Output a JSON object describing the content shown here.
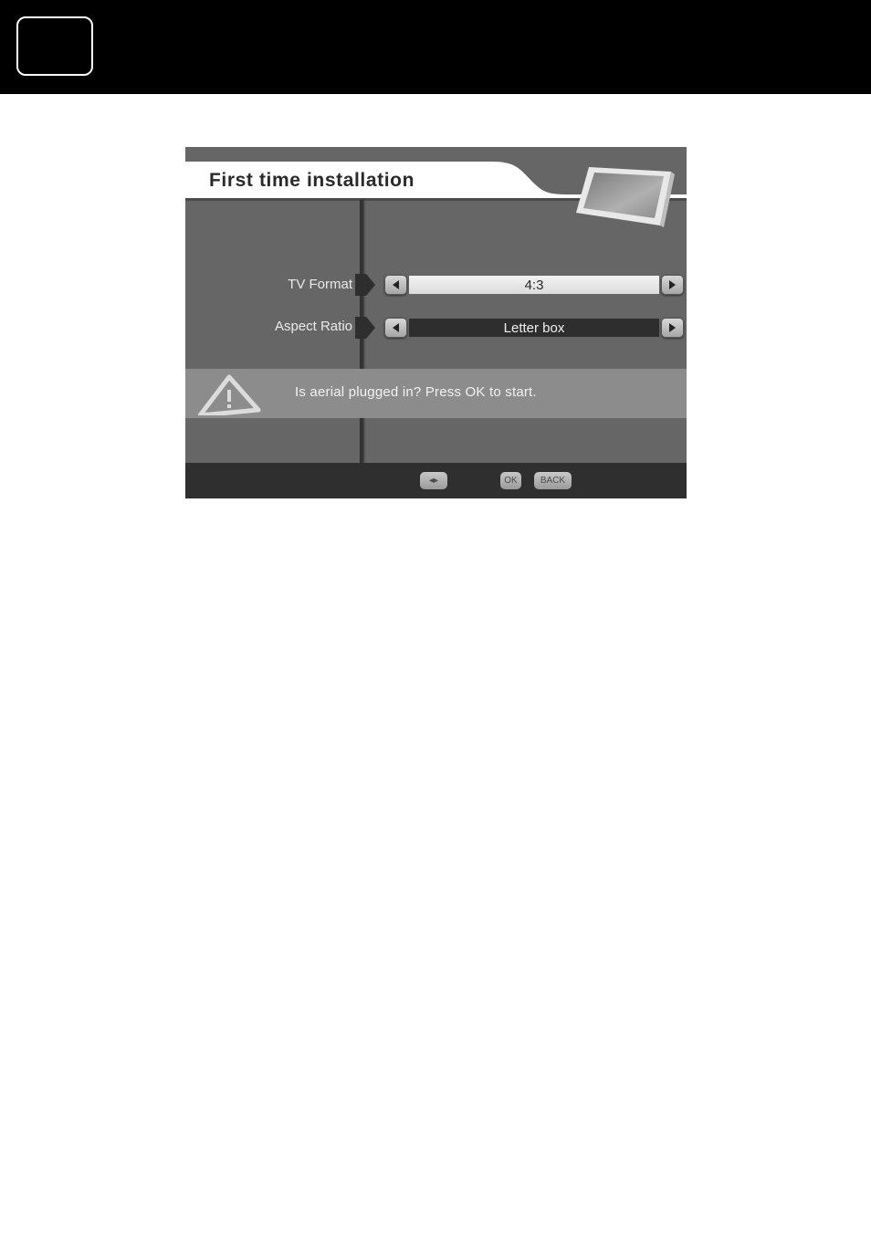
{
  "page": {
    "tab_box_label": ""
  },
  "screen": {
    "title": "First time installation",
    "header_icon": "tv-screen-icon",
    "rows": [
      {
        "label": "TV Format",
        "value": "4:3",
        "style": "highlighted"
      },
      {
        "label": "Aspect Ratio",
        "value": "Letter box",
        "style": "normal"
      }
    ],
    "message": {
      "icon": "warning-triangle-icon",
      "text": "Is aerial plugged in? Press OK to start."
    },
    "footer_keys": [
      {
        "name": "left-right-key",
        "label": "◂▸"
      },
      {
        "name": "ok-key",
        "label": "OK"
      },
      {
        "name": "back-key",
        "label": "BACK"
      }
    ]
  },
  "colors": {
    "top_bar": "#000000",
    "screen_bg": "#666666",
    "warning_band": "#8c8c8c",
    "footer_bg": "#2f2f2f"
  }
}
